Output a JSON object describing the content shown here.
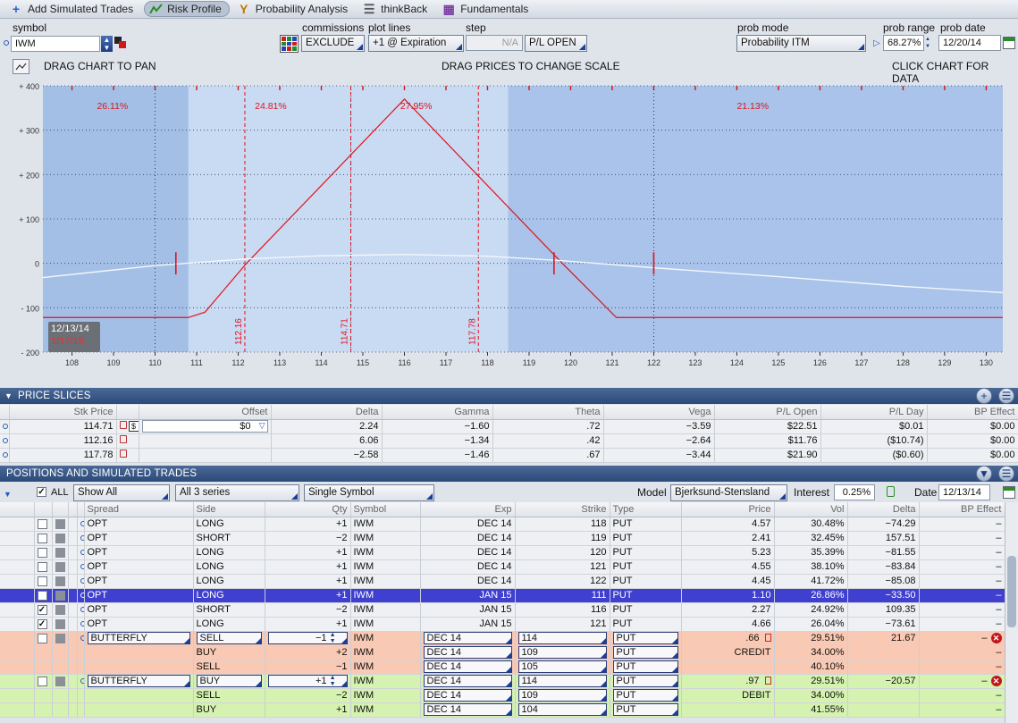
{
  "tabs": [
    {
      "label": "Add Simulated Trades",
      "icon": "plus-icon"
    },
    {
      "label": "Risk Profile",
      "icon": "risk-profile-icon"
    },
    {
      "label": "Probability Analysis",
      "icon": "probability-icon"
    },
    {
      "label": "thinkBack",
      "icon": "thinkback-icon"
    },
    {
      "label": "Fundamentals",
      "icon": "fundamentals-icon"
    }
  ],
  "controls": {
    "symbol_label": "symbol",
    "symbol_value": "IWM",
    "commissions_label": "commissions",
    "commissions_value": "EXCLUDE",
    "plot_lines_label": "plot lines",
    "plot_lines_value": "+1 @ Expiration",
    "step_label": "step",
    "step_value": "N/A",
    "pl_open": "P/L OPEN",
    "prob_mode_label": "prob mode",
    "prob_mode_value": "Probability ITM",
    "prob_range_label": "prob range",
    "prob_range_value": "68.27%",
    "prob_date_label": "prob date",
    "prob_date_value": "12/20/14"
  },
  "chart_hints": {
    "left": "DRAG CHART TO PAN",
    "center": "DRAG PRICES TO CHANGE SCALE",
    "right": "CLICK CHART FOR DATA"
  },
  "chart_data": {
    "type": "line",
    "xlim": [
      107.3,
      130.4
    ],
    "ylim": [
      -200,
      400
    ],
    "x_ticks": [
      "108",
      "109",
      "110",
      "111",
      "112",
      "113",
      "114",
      "115",
      "116",
      "117",
      "118",
      "119",
      "120",
      "121",
      "122",
      "123",
      "124",
      "125",
      "126",
      "127",
      "128",
      "129",
      "130"
    ],
    "y_ticks": [
      "+ 400",
      "+ 300",
      "+ 200",
      "+ 100",
      "0",
      "- 100",
      "- 200"
    ],
    "series": [
      {
        "name": "expiration",
        "color": "#e0141c",
        "x": [
          107.3,
          110.8,
          111.2,
          112.2,
          116.0,
          119.8,
          121.1,
          130.4
        ],
        "y": [
          -122,
          -122,
          -110,
          0,
          370,
          0,
          -122,
          -122
        ]
      },
      {
        "name": "today",
        "color": "#f4f7fb",
        "x": [
          107.3,
          110.0,
          112.2,
          114.0,
          116.0,
          118.0,
          119.8,
          122.0,
          125.0,
          128.0,
          130.4
        ],
        "y": [
          -32,
          -5,
          10,
          17,
          20,
          16,
          6,
          -10,
          -30,
          -52,
          -66
        ]
      }
    ],
    "prob_bands": [
      {
        "label": "26.11%",
        "x_from": 107.3,
        "x_to": 110.8,
        "label_x": 108.6
      },
      {
        "label": "24.81%",
        "x_from": 110.8,
        "x_to": 114.7,
        "label_x": 112.4
      },
      {
        "label": "27.95%",
        "x_from": 114.7,
        "x_to": 118.5,
        "label_x": 115.9
      },
      {
        "label": "21.13%",
        "x_from": 118.5,
        "x_to": 130.4,
        "label_x": 124.0
      }
    ],
    "price_slices": [
      {
        "value": 112.16,
        "label": "112.16"
      },
      {
        "value": 114.71,
        "label": "114.71"
      },
      {
        "value": 117.78,
        "label": "117.78"
      }
    ],
    "dotted_x": [
      110.0,
      114.71,
      122.0
    ],
    "marks_x": [
      110.5,
      119.6,
      122.0
    ],
    "dates": {
      "today": "12/13/14",
      "expiration": "1/17/15"
    },
    "grid": true
  },
  "price_slices": {
    "header": "PRICE SLICES",
    "columns": [
      "Stk Price",
      "Offset",
      "Delta",
      "Gamma",
      "Theta",
      "Vega",
      "P/L Open",
      "P/L Day",
      "BP Effect"
    ],
    "rows": [
      {
        "price": "114.71",
        "offset": "$0",
        "delta": "2.24",
        "gamma": "−1.60",
        "theta": ".72",
        "vega": "−3.59",
        "plopen": "$22.51",
        "plday": "$0.01",
        "bp": "$0.00"
      },
      {
        "price": "112.16",
        "offset": "",
        "delta": "6.06",
        "gamma": "−1.34",
        "theta": ".42",
        "vega": "−2.64",
        "plopen": "$11.76",
        "plday": "($10.74)",
        "bp": "$0.00"
      },
      {
        "price": "117.78",
        "offset": "",
        "delta": "−2.58",
        "gamma": "−1.46",
        "theta": ".67",
        "vega": "−3.44",
        "plopen": "$21.90",
        "plday": "($0.60)",
        "bp": "$0.00"
      }
    ]
  },
  "positions": {
    "header": "POSITIONS AND SIMULATED TRADES",
    "all_label": "ALL",
    "show_filter": "Show All",
    "series_filter": "All 3 series",
    "symbol_mode": "Single Symbol",
    "model_label": "Model",
    "model_value": "Bjerksund-Stensland",
    "interest_label": "Interest",
    "interest_value": "0.25%",
    "date_label": "Date",
    "date_value": "12/13/14",
    "columns": [
      "Spread",
      "Side",
      "Qty",
      "Symbol",
      "Exp",
      "Strike",
      "Type",
      "Price",
      "Vol",
      "Delta",
      "BP Effect"
    ],
    "rows": [
      {
        "kind": "plain",
        "checked": false,
        "spread": "OPT",
        "side": "LONG",
        "qty": "+1",
        "sym": "IWM",
        "exp": "DEC 14",
        "strike": "118",
        "type": "PUT",
        "price": "4.57",
        "vol": "30.48%",
        "delta": "−74.29",
        "bp": "–"
      },
      {
        "kind": "plain",
        "checked": false,
        "spread": "OPT",
        "side": "SHORT",
        "qty": "−2",
        "sym": "IWM",
        "exp": "DEC 14",
        "strike": "119",
        "type": "PUT",
        "price": "2.41",
        "vol": "32.45%",
        "delta": "157.51",
        "bp": "–"
      },
      {
        "kind": "plain",
        "checked": false,
        "spread": "OPT",
        "side": "LONG",
        "qty": "+1",
        "sym": "IWM",
        "exp": "DEC 14",
        "strike": "120",
        "type": "PUT",
        "price": "5.23",
        "vol": "35.39%",
        "delta": "−81.55",
        "bp": "–"
      },
      {
        "kind": "plain",
        "checked": false,
        "spread": "OPT",
        "side": "LONG",
        "qty": "+1",
        "sym": "IWM",
        "exp": "DEC 14",
        "strike": "121",
        "type": "PUT",
        "price": "4.55",
        "vol": "38.10%",
        "delta": "−83.84",
        "bp": "–"
      },
      {
        "kind": "plain",
        "checked": false,
        "spread": "OPT",
        "side": "LONG",
        "qty": "+1",
        "sym": "IWM",
        "exp": "DEC 14",
        "strike": "122",
        "type": "PUT",
        "price": "4.45",
        "vol": "41.72%",
        "delta": "−85.08",
        "bp": "–"
      },
      {
        "kind": "sel",
        "checked": true,
        "spread": "OPT",
        "side": "LONG",
        "qty": "+1",
        "sym": "IWM",
        "exp": "JAN 15",
        "strike": "111",
        "type": "PUT",
        "price": "1.10",
        "vol": "26.86%",
        "delta": "−33.50",
        "bp": "–"
      },
      {
        "kind": "plain",
        "checked": true,
        "spread": "OPT",
        "side": "SHORT",
        "qty": "−2",
        "sym": "IWM",
        "exp": "JAN 15",
        "strike": "116",
        "type": "PUT",
        "price": "2.27",
        "vol": "24.92%",
        "delta": "109.35",
        "bp": "–"
      },
      {
        "kind": "plain",
        "checked": true,
        "spread": "OPT",
        "side": "LONG",
        "qty": "+1",
        "sym": "IWM",
        "exp": "JAN 15",
        "strike": "121",
        "type": "PUT",
        "price": "4.66",
        "vol": "26.04%",
        "delta": "−73.61",
        "bp": "–"
      },
      {
        "kind": "sell",
        "checked": false,
        "head": true,
        "spread": "BUTTERFLY",
        "side": "SELL",
        "qty": "−1",
        "sym": "IWM",
        "exp": "DEC 14",
        "strike": "114",
        "type": "PUT",
        "price": ".66",
        "vol": "29.51%",
        "delta": "21.67",
        "bp": "–"
      },
      {
        "kind": "sell",
        "leg": true,
        "spread": "",
        "side": "BUY",
        "qty": "+2",
        "sym": "IWM",
        "exp": "DEC 14",
        "strike": "109",
        "type": "PUT",
        "price": "CREDIT",
        "vol": "34.00%",
        "delta": "",
        "bp": "–"
      },
      {
        "kind": "sell",
        "leg": true,
        "spread": "",
        "side": "SELL",
        "qty": "−1",
        "sym": "IWM",
        "exp": "DEC 14",
        "strike": "105",
        "type": "PUT",
        "price": "",
        "vol": "40.10%",
        "delta": "",
        "bp": "–"
      },
      {
        "kind": "buy",
        "checked": false,
        "head": true,
        "spread": "BUTTERFLY",
        "side": "BUY",
        "qty": "+1",
        "sym": "IWM",
        "exp": "DEC 14",
        "strike": "114",
        "type": "PUT",
        "price": ".97",
        "vol": "29.51%",
        "delta": "−20.57",
        "bp": "–"
      },
      {
        "kind": "buy",
        "leg": true,
        "spread": "",
        "side": "SELL",
        "qty": "−2",
        "sym": "IWM",
        "exp": "DEC 14",
        "strike": "109",
        "type": "PUT",
        "price": "DEBIT",
        "vol": "34.00%",
        "delta": "",
        "bp": "–"
      },
      {
        "kind": "buy",
        "leg": true,
        "spread": "",
        "side": "BUY",
        "qty": "+1",
        "sym": "IWM",
        "exp": "DEC 14",
        "strike": "104",
        "type": "PUT",
        "price": "",
        "vol": "41.55%",
        "delta": "",
        "bp": "–"
      }
    ]
  }
}
